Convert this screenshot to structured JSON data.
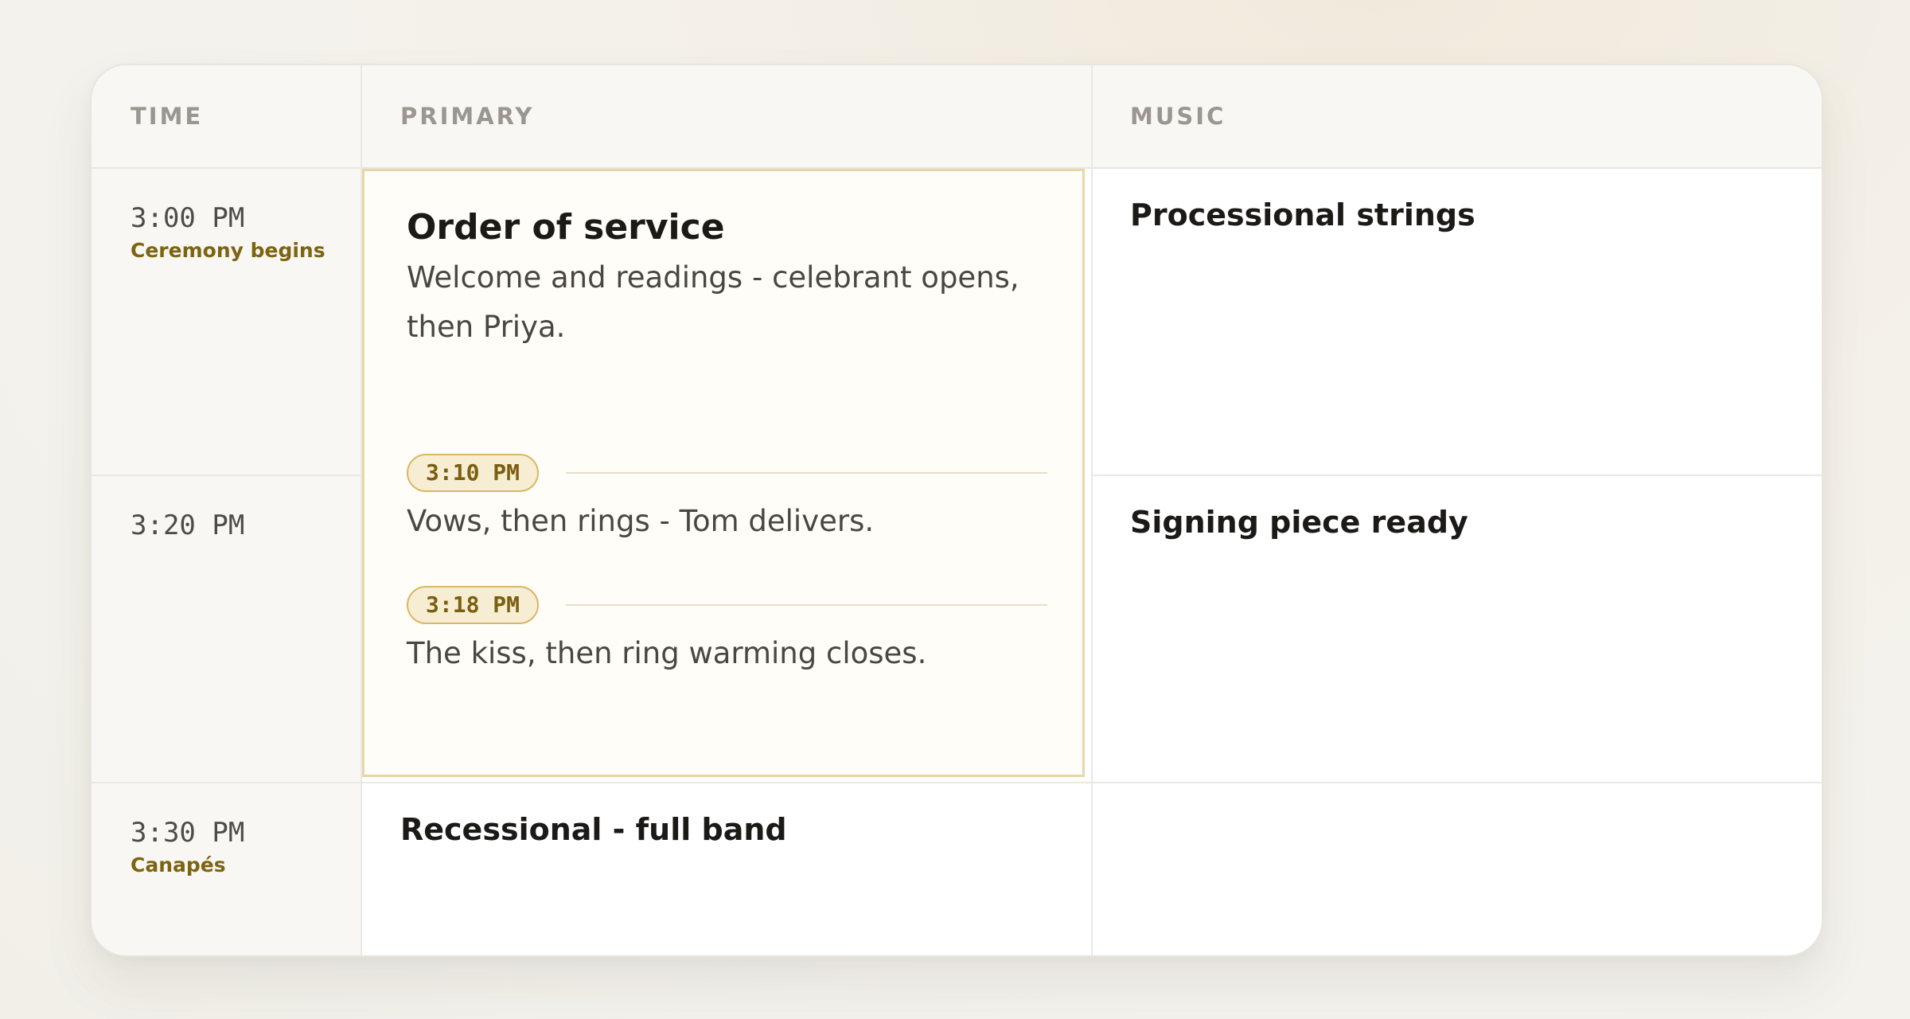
{
  "columns": {
    "time": "TIME",
    "primary": "PRIMARY",
    "music": "MUSIC"
  },
  "slots": [
    {
      "time": "3:00 PM",
      "note": "Ceremony begins"
    },
    {
      "time": "3:20 PM",
      "note": ""
    },
    {
      "time": "3:30 PM",
      "note": "Canapés"
    }
  ],
  "primary_block": {
    "title": "Order of service",
    "segments": [
      {
        "text": "Welcome and readings - celebrant opens, then Priya."
      },
      {
        "marker": "3:10 PM",
        "text": "Vows, then rings - Tom delivers."
      },
      {
        "marker": "3:18 PM",
        "text": "The kiss, then ring warming closes."
      }
    ]
  },
  "primary_cells": {
    "row3": "Recessional - full band"
  },
  "music_cells": {
    "row1": "Processional strings",
    "row2": "Signing piece ready",
    "row3": ""
  },
  "colors": {
    "accent_text": "#7d6410",
    "highlight_border": "#e6d6a8",
    "highlight_bg": "#fffdf7",
    "pill_bg": "#f7edd2",
    "pill_border": "#d9b867"
  }
}
